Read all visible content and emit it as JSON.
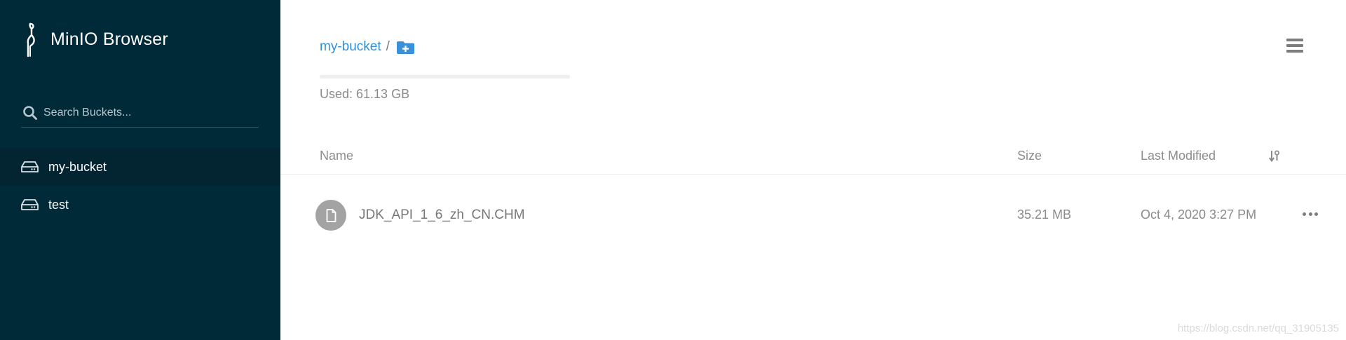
{
  "app": {
    "title": "MinIO Browser"
  },
  "search": {
    "placeholder": "Search Buckets..."
  },
  "sidebar": {
    "buckets": [
      {
        "label": "my-bucket",
        "active": true
      },
      {
        "label": "test",
        "active": false
      }
    ]
  },
  "breadcrumb": {
    "bucket": "my-bucket",
    "separator": "/"
  },
  "usage": {
    "text": "Used: 61.13 GB",
    "fraction": 0
  },
  "table": {
    "headers": {
      "name": "Name",
      "size": "Size",
      "modified": "Last Modified"
    },
    "rows": [
      {
        "name": "JDK_API_1_6_zh_CN.CHM",
        "size": "35.21 MB",
        "modified": "Oct 4, 2020 3:27 PM"
      }
    ]
  },
  "watermark": "https://blog.csdn.net/qq_31905135",
  "colors": {
    "sidebar": "#002a37",
    "accent": "#2f8fd8",
    "text_muted": "#8c8c8c"
  },
  "icons": {
    "logo": "minio-bird-icon",
    "search": "search-icon",
    "bucket": "hard-drive-icon",
    "add_folder": "folder-plus-icon",
    "menu": "hamburger-menu-icon",
    "sort": "sort-icon",
    "file": "file-icon",
    "more": "more-dots-icon"
  }
}
